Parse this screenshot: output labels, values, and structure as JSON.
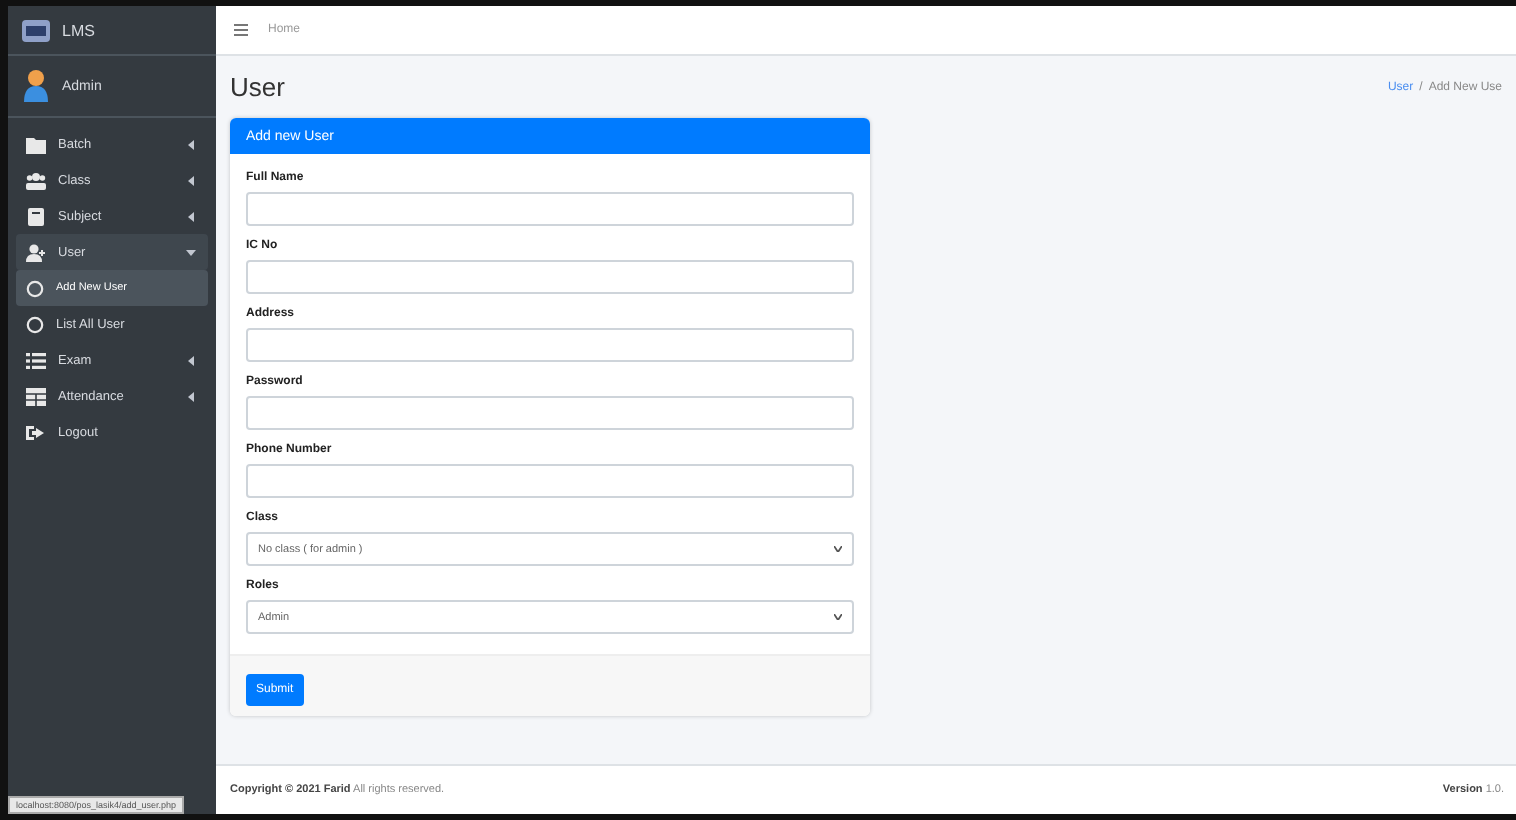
{
  "brand": {
    "title": "LMS"
  },
  "user_panel": {
    "name": "Admin"
  },
  "sidebar": {
    "items": [
      {
        "label": "Batch",
        "expanded": false
      },
      {
        "label": "Class",
        "expanded": false
      },
      {
        "label": "Subject",
        "expanded": false
      },
      {
        "label": "User",
        "expanded": true,
        "children": [
          {
            "label": "Add New User",
            "selected": true
          },
          {
            "label": "List All User",
            "selected": false
          }
        ]
      },
      {
        "label": "Exam",
        "expanded": false
      },
      {
        "label": "Attendance",
        "expanded": false
      },
      {
        "label": "Logout"
      }
    ]
  },
  "navbar": {
    "links": [
      "Home"
    ]
  },
  "page": {
    "title": "User",
    "breadcrumb": [
      {
        "label": "User",
        "kind": "link"
      },
      {
        "label": "/",
        "kind": "separator"
      },
      {
        "label": "Add New Use",
        "kind": "current"
      }
    ]
  },
  "card": {
    "title": "Add new User",
    "fields": [
      {
        "label": "Full Name",
        "kind": "text"
      },
      {
        "label": "IC No",
        "kind": "text"
      },
      {
        "label": "Address",
        "kind": "text"
      },
      {
        "label": "Password",
        "kind": "text"
      },
      {
        "label": "Phone Number",
        "kind": "text"
      },
      {
        "label": "Class",
        "kind": "select",
        "value": "No class ( for admin )"
      },
      {
        "label": "Roles",
        "kind": "select",
        "value": "Admin"
      }
    ],
    "submit": "Submit"
  },
  "footer": {
    "copyright_prefix": "Copyright © 2021 Farid",
    "copyright_rest": "All rights reserved.",
    "version_label": "Version",
    "version": "1.0."
  },
  "status_url": "localhost:8080/pos_lasik4/add_user.php"
}
